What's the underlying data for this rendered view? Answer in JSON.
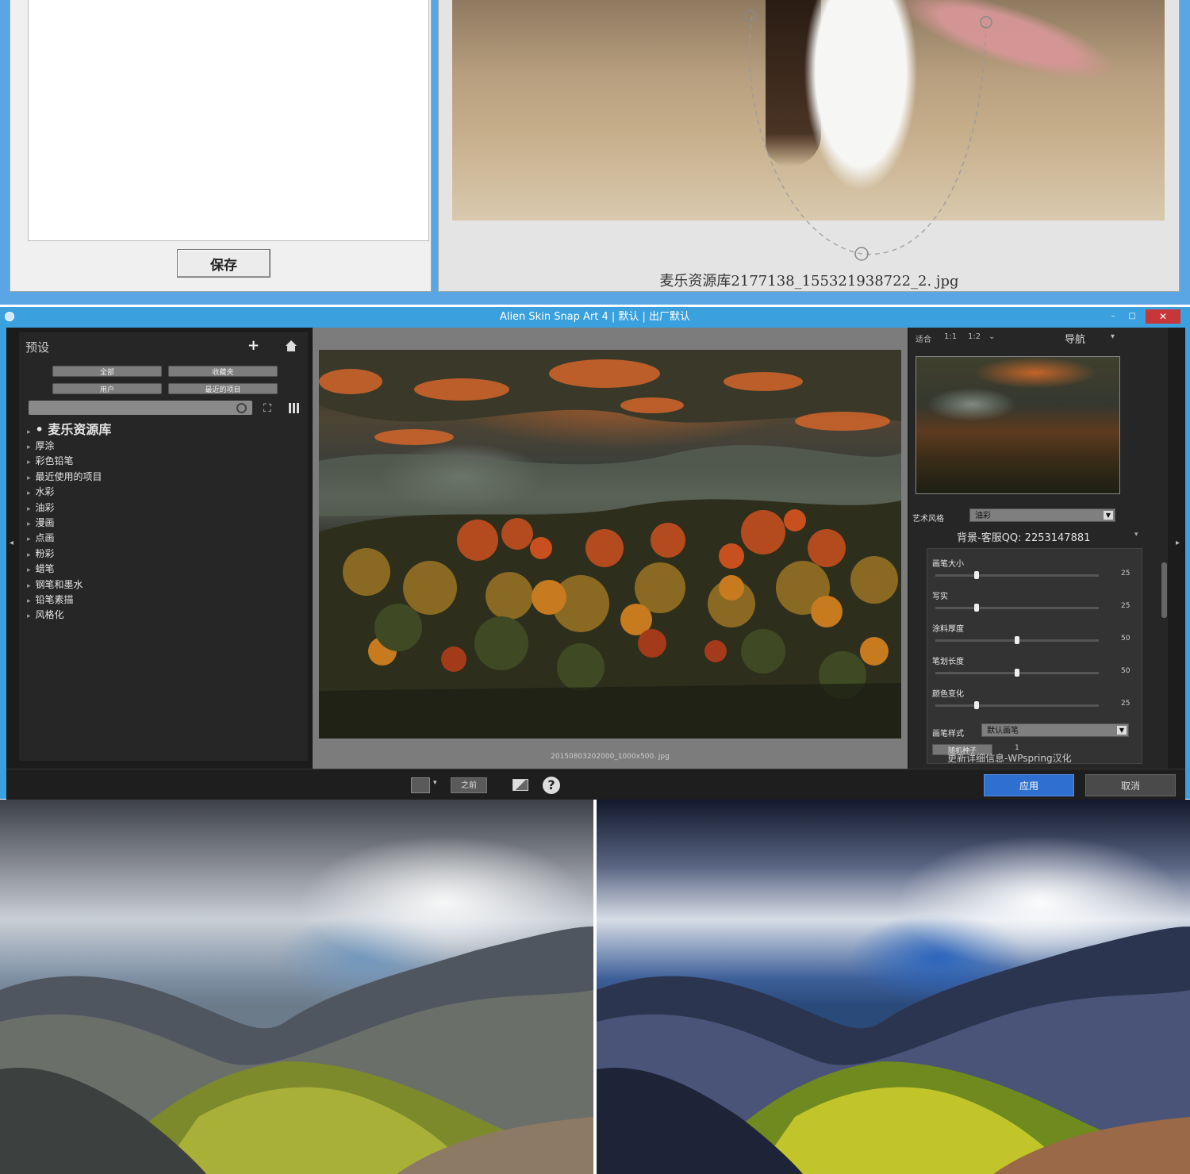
{
  "top_window": {
    "save_button": "保存",
    "filename": "麦乐资源库2177138_155321938722_2. jpg"
  },
  "snap_window": {
    "title": "Alien Skin Snap Art 4 | 默认 | 出厂默认",
    "controls": {
      "minimize": "–",
      "maximize": "□",
      "close": "✕"
    },
    "left_panel": {
      "title": "预设",
      "add_icon": "+",
      "buttons": [
        "全部",
        "收藏夹",
        "用户",
        "最近的项目"
      ],
      "search_placeholder": "",
      "root_item": "• 麦乐资源库",
      "items": [
        "厚涂",
        "彩色铅笔",
        "最近使用的项目",
        "水彩",
        "油彩",
        "漫画",
        "点画",
        "粉彩",
        "蜡笔",
        "钢笔和墨水",
        "铅笔素描",
        "风格化"
      ]
    },
    "canvas": {
      "filename": "20150803202000_1000x500. jpg"
    },
    "right_panel": {
      "zoom_fit": "适合",
      "zoom_1_1": "1:1",
      "zoom_1_2": "1:2",
      "navigator_title": "导航",
      "art_style_label": "艺术风格",
      "art_style_value": "油彩",
      "section_header": "背景-客服QQ: 2253147881",
      "sliders": [
        {
          "label": "画笔大小",
          "value": 25
        },
        {
          "label": "写实",
          "value": 25
        },
        {
          "label": "涂料厚度",
          "value": 50
        },
        {
          "label": "笔划长度",
          "value": 50
        },
        {
          "label": "颜色变化",
          "value": 25
        }
      ],
      "brush_style_label": "画笔样式",
      "brush_style_value": "默认画笔",
      "random_seed_button": "随机种子",
      "random_seed_value": "1",
      "footer_note": "更新详细信息-WPspring汉化"
    },
    "toolbar": {
      "before_button": "之前",
      "help_icon": "?",
      "apply_button": "应用",
      "cancel_button": "取消"
    }
  },
  "photos": {
    "before": "mountain-photo-original",
    "after": "mountain-photo-processed"
  }
}
